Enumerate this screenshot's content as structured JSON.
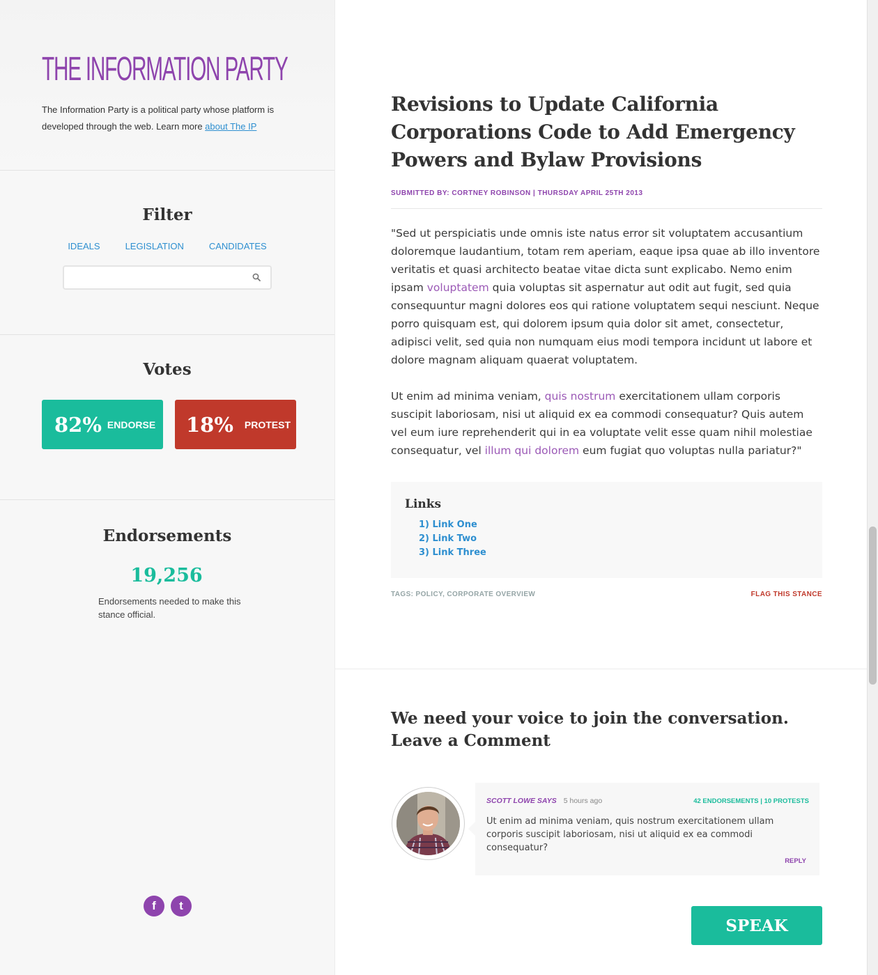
{
  "brand": {
    "logo": "THE INFORMATION PARTY",
    "intro": "The Information Party is a political party whose platform is developed through the web. Learn more ",
    "intro_link": "about The IP"
  },
  "filter": {
    "title": "Filter",
    "tabs": [
      "IDEALS",
      "LEGISLATION",
      "CANDIDATES"
    ],
    "search_placeholder": "",
    "search_value": ""
  },
  "votes": {
    "title": "Votes",
    "endorse_pct": "82%",
    "endorse_label": "ENDORSE",
    "protest_pct": "18%",
    "protest_label": "PROTEST",
    "endorse_value": 82,
    "protest_value": 18
  },
  "endorsements": {
    "title": "Endorsements",
    "count": "19,256",
    "note": "Endorsements needed to make this stance official."
  },
  "social": {
    "facebook_glyph": "f",
    "twitter_glyph": "t",
    "icons": [
      "facebook-icon",
      "twitter-icon"
    ]
  },
  "article": {
    "title": "Revisions to Update California Corporations Code to Add Emergency Powers and Bylaw Provisions",
    "meta": "SUBMITTED BY: CORTNEY ROBINSON | THURSDAY APRIL 25TH 2013",
    "p1_a": "\"Sed ut perspiciatis unde omnis iste natus error sit voluptatem accusantium doloremque laudantium, totam rem aperiam, eaque ipsa quae ab illo inventore veritatis et quasi architecto beatae vitae dicta sunt explicabo. Nemo enim ipsam ",
    "p1_link": "voluptatem",
    "p1_b": " quia voluptas sit aspernatur aut odit aut fugit, sed quia consequuntur magni dolores eos qui ratione voluptatem sequi nesciunt. Neque porro quisquam est, qui dolorem ipsum quia dolor sit amet, consectetur, adipisci velit, sed quia non numquam eius modi tempora incidunt ut labore et dolore magnam aliquam quaerat voluptatem.",
    "p2_a": "Ut enim ad minima veniam, ",
    "p2_link1": "quis nostrum",
    "p2_b": " exercitationem ullam corporis suscipit laboriosam, nisi ut aliquid ex ea commodi consequatur? Quis autem vel eum iure reprehenderit qui in ea voluptate velit esse quam nihil molestiae consequatur, vel ",
    "p2_link2": "illum qui dolorem",
    "p2_c": " eum fugiat quo voluptas nulla pariatur?\"",
    "links_title": "Links",
    "links": [
      "1) Link One",
      "2) Link Two",
      "3) Link Three"
    ],
    "tags": "TAGS: POLICY, CORPORATE OVERVIEW",
    "flag": "FLAG THIS STANCE"
  },
  "comments": {
    "heading_line1": "We need your voice to join the conversation.",
    "heading_line2": "Leave a Comment",
    "items": [
      {
        "author": "SCOTT LOWE SAYS",
        "time": "5 hours ago",
        "stats": "42 ENDORSEMENTS | 10 PROTESTS",
        "text": "Ut enim ad minima veniam, quis nostrum exercitationem ullam corporis suscipit laboriosam, nisi ut aliquid ex ea commodi consequatur?",
        "reply": "REPLY"
      }
    ],
    "speak_label": "SPEAK"
  },
  "colors": {
    "purple": "#8e44ad",
    "teal": "#1abc9c",
    "red": "#c0392b",
    "blue": "#2e8fd0"
  }
}
